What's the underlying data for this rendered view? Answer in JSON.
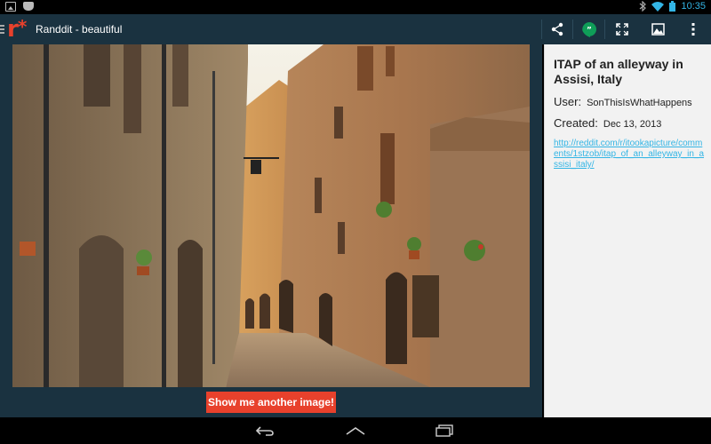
{
  "statusbar": {
    "time": "10:35",
    "icons": [
      "gallery-notification-icon",
      "cat-notification-icon",
      "bluetooth-icon",
      "wifi-icon",
      "battery-icon"
    ]
  },
  "actionbar": {
    "app_logo": "r*",
    "title": "Randdit - beautiful",
    "accent_color": "#e8412c",
    "bar_color": "#1a3240",
    "actions": [
      "share-icon",
      "hangouts-icon",
      "fullscreen-icon",
      "wallpaper-icon",
      "overflow-menu-icon"
    ]
  },
  "main": {
    "show_another_label": "Show me another image!"
  },
  "post": {
    "title": "ITAP of an alleyway in Assisi, Italy",
    "user_label": "User:",
    "user": "SonThisIsWhatHappens",
    "created_label": "Created:",
    "created": "Dec 13, 2013",
    "link": "http://reddit.com/r/itookapicture/comments/1stzob/itap_of_an_alleyway_in_assisi_italy/",
    "link_color": "#33b5e5"
  },
  "navbar": {
    "icons": [
      "back-icon",
      "home-icon",
      "recents-icon"
    ]
  }
}
